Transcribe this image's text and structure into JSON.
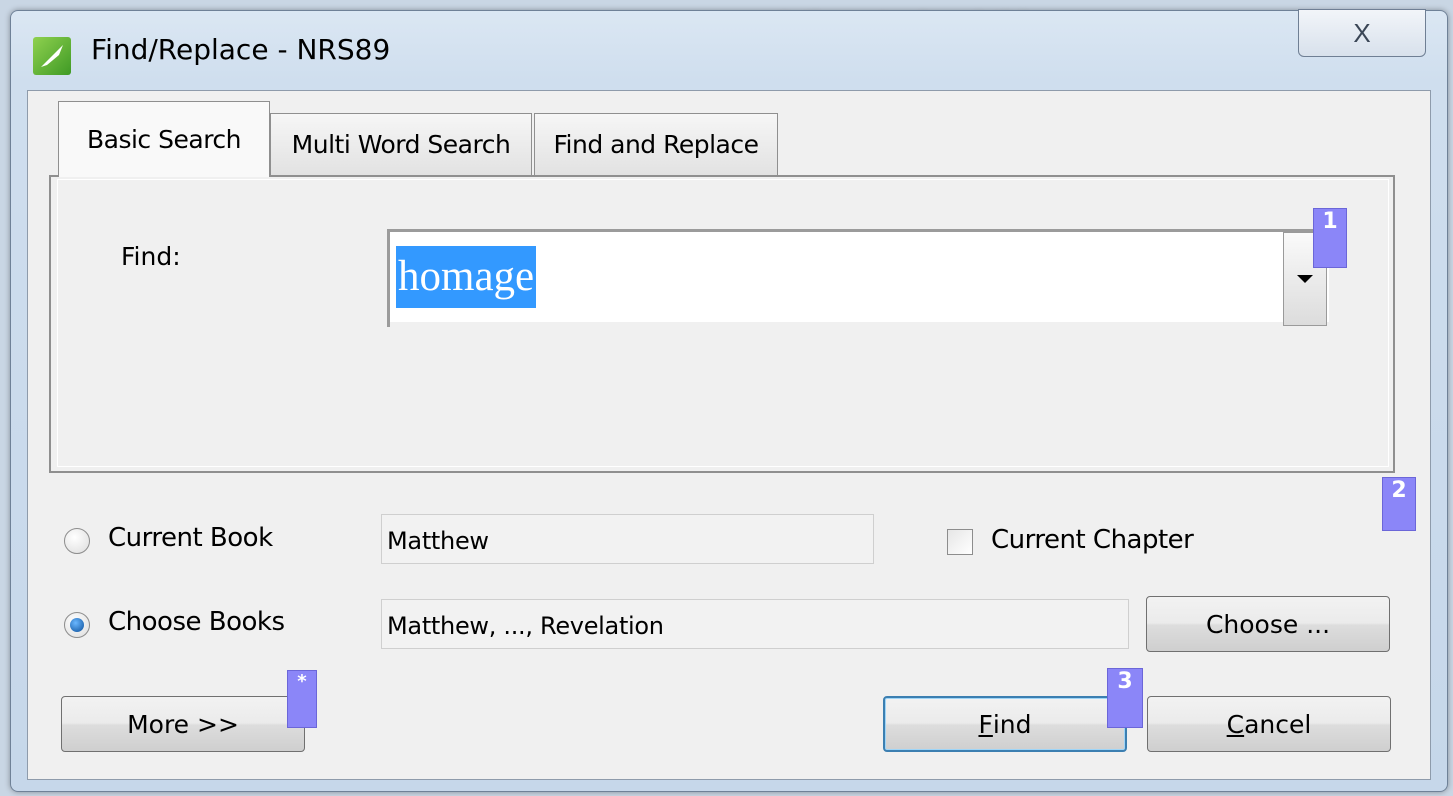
{
  "window": {
    "title": "Find/Replace - NRS89",
    "close_glyph": "X"
  },
  "tabs": [
    {
      "label": "Basic Search",
      "active": true
    },
    {
      "label": "Multi Word Search",
      "active": false
    },
    {
      "label": "Find and Replace",
      "active": false
    }
  ],
  "find": {
    "label": "Find:",
    "value": "homage"
  },
  "scope": {
    "current_book_label": "Current Book",
    "current_book_selected": false,
    "current_book_value": "Matthew",
    "current_chapter_label": "Current Chapter",
    "current_chapter_checked": false,
    "choose_books_label": "Choose Books",
    "choose_books_selected": true,
    "choose_books_value": "Matthew, ..., Revelation",
    "choose_button": "Choose ..."
  },
  "buttons": {
    "more": "More >>",
    "find_first": "F",
    "find_rest": "ind",
    "cancel_first": "C",
    "cancel_rest": "ancel"
  },
  "badges": [
    "1",
    "2",
    "*",
    "3"
  ],
  "colors": {
    "selection": "#3399ff",
    "badge": "#8b86f8"
  }
}
